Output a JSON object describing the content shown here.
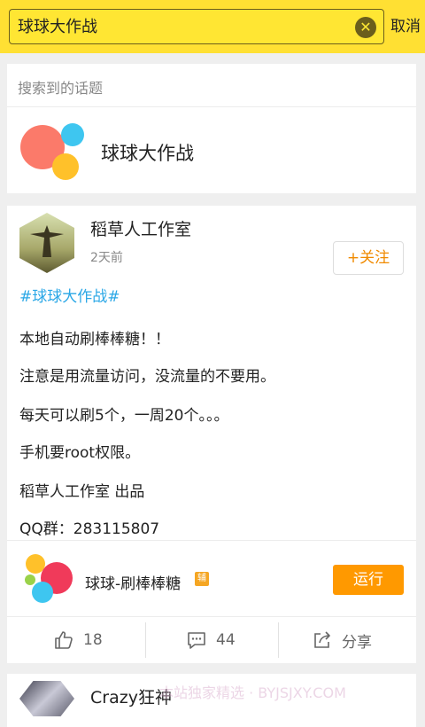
{
  "search": {
    "query": "球球大作战",
    "cancel_label": "取消"
  },
  "topics": {
    "header": "搜索到的话题",
    "items": [
      {
        "title": "球球大作战",
        "icon": "colorful-balls-logo"
      }
    ]
  },
  "post": {
    "author": "稻草人工作室",
    "time": "2天前",
    "follow_label": "+关注",
    "hashtag": "#球球大作战#",
    "lines": [
      "本地自动刷棒棒糖！！",
      "注意是用流量访问，没流量的不要用。",
      "每天可以刷5个，一周20个。。。",
      "手机要root权限。",
      "稻草人工作室  出品",
      "QQ群：283115807"
    ],
    "app": {
      "name": "球球-刷棒棒糖",
      "badge": "辅",
      "run_label": "运行"
    },
    "actions": {
      "likes": "18",
      "comments": "44",
      "share_label": "分享"
    }
  },
  "next_post": {
    "author": "Crazy狂神"
  },
  "watermark": "本站独家精选 · BYJSJXY.COM",
  "colors": {
    "topbar": "#ffe033",
    "accent_orange": "#ff9900",
    "hashtag_blue": "#2aa7e6"
  }
}
